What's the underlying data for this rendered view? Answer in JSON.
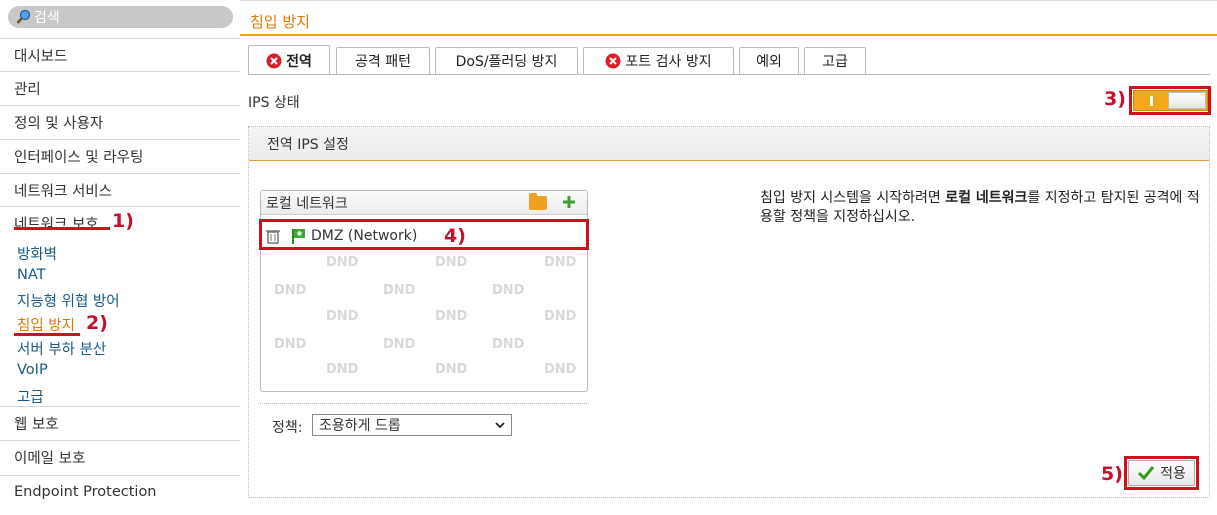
{
  "search": {
    "placeholder": "검색"
  },
  "sidebar": {
    "items": [
      {
        "label": "대시보드"
      },
      {
        "label": "관리"
      },
      {
        "label": "정의 및 사용자"
      },
      {
        "label": "인터페이스 및 라우팅"
      },
      {
        "label": "네트워크 서비스"
      },
      {
        "label": "네트워크 보호"
      }
    ],
    "subitems": [
      {
        "label": "방화벽"
      },
      {
        "label": "NAT"
      },
      {
        "label": "지능형 위협 방어"
      },
      {
        "label": "침입 방지"
      },
      {
        "label": "서버 부하 분산"
      },
      {
        "label": "VoIP"
      },
      {
        "label": "고급"
      }
    ],
    "bottom_items": [
      {
        "label": "웹 보호"
      },
      {
        "label": "이메일 보호"
      },
      {
        "label": "Endpoint Protection"
      }
    ]
  },
  "header": {
    "title": "침입 방지"
  },
  "tabs": [
    {
      "label": "전역"
    },
    {
      "label": "공격 패턴"
    },
    {
      "label": "DoS/플러딩 방지"
    },
    {
      "label": "포트 검사 방지"
    },
    {
      "label": "예외"
    },
    {
      "label": "고급"
    }
  ],
  "ips_status": {
    "label": "IPS 상태",
    "enabled": true
  },
  "panel": {
    "title": "전역 IPS 설정",
    "local_networks": {
      "header": "로컬 네트워크",
      "items": [
        {
          "label": "DMZ (Network)"
        }
      ],
      "dnd_text": "DND"
    },
    "policy_label": "정책:",
    "policy_value": "조용하게 드롭",
    "description_pre": "침입 방지 시스템을 시작하려면 ",
    "description_bold": "로컬 네트워크",
    "description_post": "를 지정하고 탐지된 공격에 적용할 정책을 지정하십시오.",
    "apply_label": "적용"
  },
  "annotations": [
    "1)",
    "2)",
    "3)",
    "4)",
    "5)"
  ],
  "colors": {
    "accent": "#e07a00",
    "toggle_on": "#f3a81c",
    "annotation_red": "#d0101c",
    "link": "#1a5a8a"
  }
}
